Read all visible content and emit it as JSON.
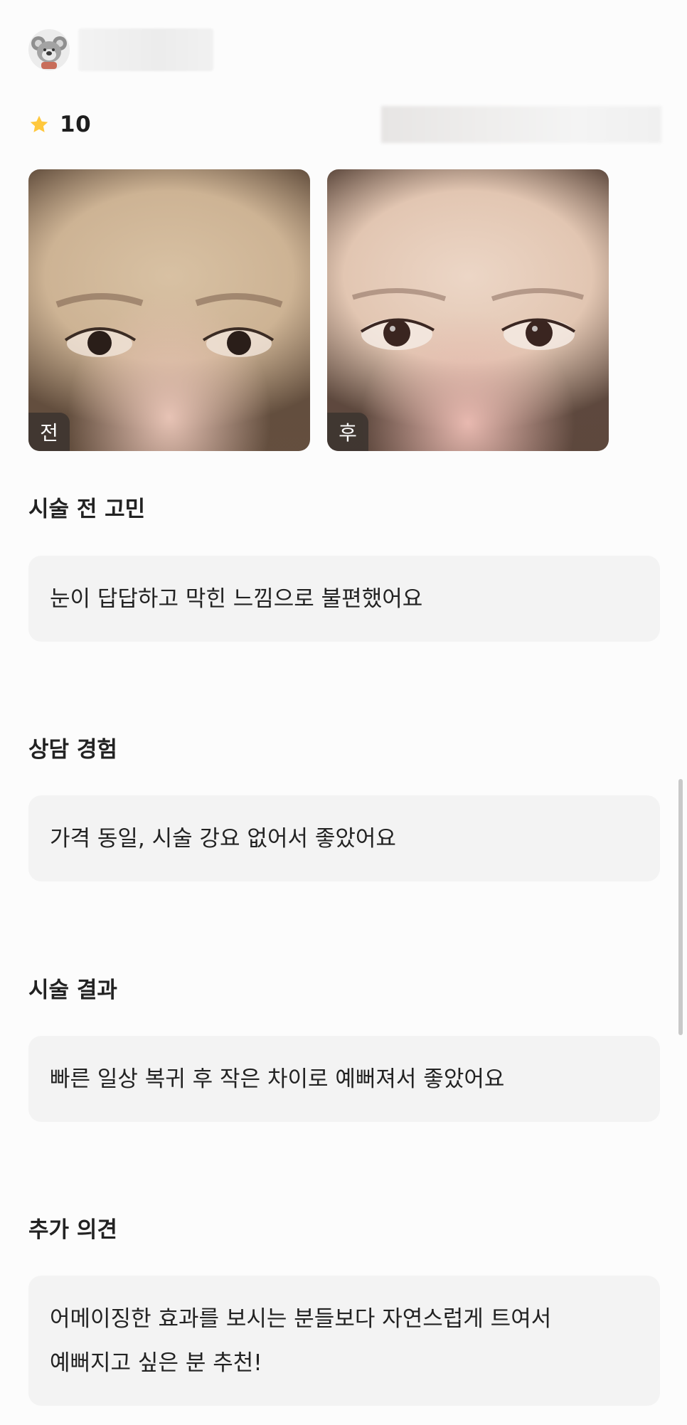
{
  "reviewer": {
    "avatar_icon": "koala-avatar-icon",
    "name_obscured": true
  },
  "rating": {
    "icon": "star-icon",
    "value": "10",
    "star_color": "#FFC83D"
  },
  "photos": [
    {
      "label": "전",
      "kind": "before"
    },
    {
      "label": "후",
      "kind": "after"
    }
  ],
  "sections": [
    {
      "title": "시술 전 고민",
      "answer": "눈이 답답하고 막힌 느낌으로 불편했어요"
    },
    {
      "title": "상담 경험",
      "answer": "가격 동일, 시술 강요 없어서 좋았어요"
    },
    {
      "title": "시술 결과",
      "answer": "빠른 일상 복귀 후 작은 차이로 예뻐져서 좋았어요"
    },
    {
      "title": "추가 의견",
      "answer_lines": [
        "어메이징한 효과를 보시는 분들보다 자연스럽게 트여서",
        "예뻐지고 싶은 분 추천!"
      ]
    }
  ]
}
